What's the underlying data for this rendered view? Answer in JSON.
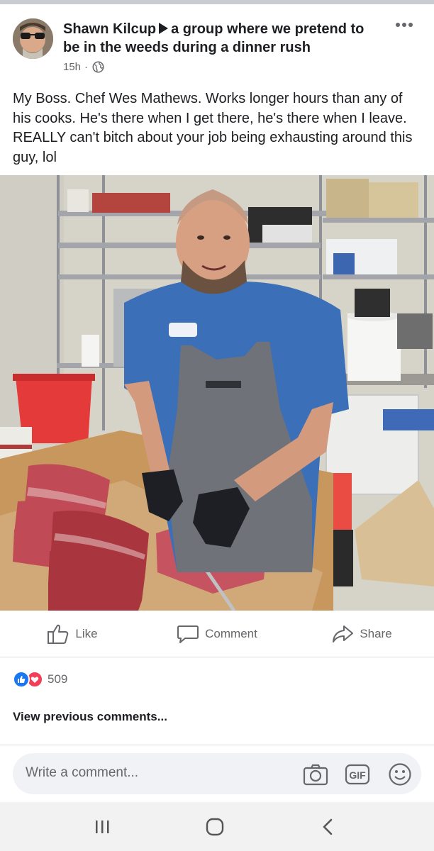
{
  "post": {
    "author": "Shawn Kilcup",
    "group": "a group where we pretend to be in the weeds during a dinner rush",
    "time": "15h",
    "separator": "·",
    "text": "My Boss. Chef Wes Mathews. Works longer hours than any of his cooks. He's there when I get there, he's there when I leave. REALLY can't bitch about your job being exhausting around this guy, lol",
    "more_icon": "more-options-icon",
    "privacy_icon": "globe-icon"
  },
  "actions": {
    "like": "Like",
    "comment": "Comment",
    "share": "Share"
  },
  "reactions": {
    "count": "509",
    "types": [
      "like",
      "love"
    ]
  },
  "comments": {
    "view_previous": "View previous comments...",
    "placeholder": "Write a comment...",
    "icons": [
      "camera-icon",
      "gif-icon",
      "emoji-icon"
    ],
    "gif_label": "GIF"
  },
  "navigation": {
    "buttons": [
      "recent-apps-icon",
      "home-icon",
      "back-icon"
    ]
  },
  "colors": {
    "like_blue": "#1877f2",
    "love_red": "#f33e58",
    "secondary_text": "#65676b"
  }
}
